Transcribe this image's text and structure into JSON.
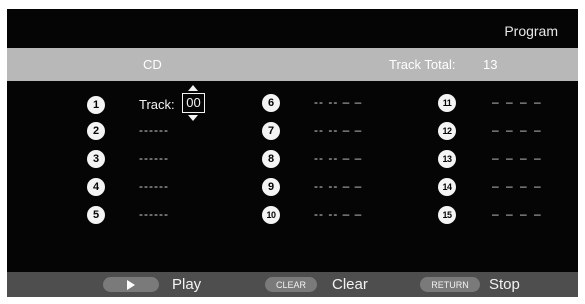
{
  "screen": {
    "title": "Program",
    "source": "CD",
    "track_total_label": "Track Total:",
    "track_total_value": "13"
  },
  "edit": {
    "label": "Track:",
    "value": "00"
  },
  "slots": [
    {
      "number": "1",
      "value": ""
    },
    {
      "number": "2",
      "value": "------"
    },
    {
      "number": "3",
      "value": "------"
    },
    {
      "number": "4",
      "value": "------"
    },
    {
      "number": "5",
      "value": "------"
    },
    {
      "number": "6",
      "value": "-- -- – –"
    },
    {
      "number": "7",
      "value": "-- -- – –"
    },
    {
      "number": "8",
      "value": "-- -- – –"
    },
    {
      "number": "9",
      "value": "-- -- – –"
    },
    {
      "number": "10",
      "value": "-- -- – –"
    },
    {
      "number": "11",
      "value": "– – – –"
    },
    {
      "number": "12",
      "value": "– – – –"
    },
    {
      "number": "13",
      "value": "– – – –"
    },
    {
      "number": "14",
      "value": "– – – –"
    },
    {
      "number": "15",
      "value": "– – – –"
    }
  ],
  "footer": {
    "play_label": "Play",
    "clear_key": "CLEAR",
    "clear_label": "Clear",
    "return_key": "RETURN",
    "stop_label": "Stop"
  },
  "icons": {
    "play": "play-icon",
    "up": "arrow-up-icon",
    "down": "arrow-down-icon"
  }
}
